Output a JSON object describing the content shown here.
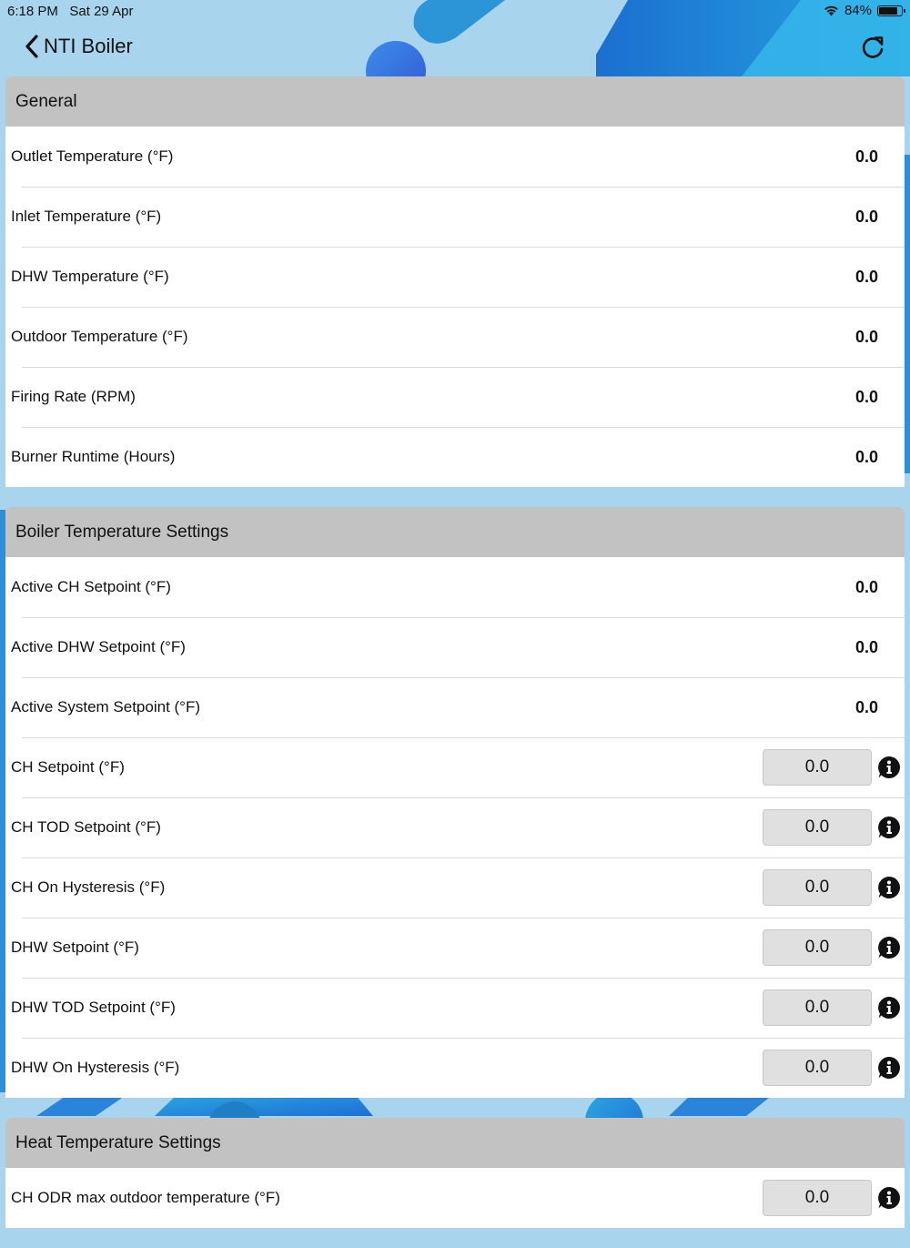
{
  "status_bar": {
    "time": "6:18 PM",
    "date": "Sat 29 Apr",
    "battery": "84%",
    "battery_level": 0.84
  },
  "nav": {
    "back_label": "NTI Boiler",
    "back_icon": "chevron-left-icon",
    "refresh_icon": "refresh-icon"
  },
  "sections": [
    {
      "title": "General",
      "rows": [
        {
          "label": "Outlet Temperature (°F)",
          "value": "0.0"
        },
        {
          "label": "Inlet Temperature (°F)",
          "value": "0.0"
        },
        {
          "label": "DHW Temperature (°F)",
          "value": "0.0"
        },
        {
          "label": "Outdoor Temperature (°F)",
          "value": "0.0"
        },
        {
          "label": "Firing Rate (RPM)",
          "value": "0.0"
        },
        {
          "label": "Burner Runtime (Hours)",
          "value": "0.0"
        }
      ]
    },
    {
      "title": "Boiler Temperature Settings",
      "rows": [
        {
          "label": "Active CH Setpoint (°F)",
          "value": "0.0"
        },
        {
          "label": "Active DHW Setpoint (°F)",
          "value": "0.0"
        },
        {
          "label": "Active System Setpoint (°F)",
          "value": "0.0"
        },
        {
          "label": "CH Setpoint (°F)",
          "input": "0.0"
        },
        {
          "label": "CH TOD Setpoint (°F)",
          "input": "0.0"
        },
        {
          "label": "CH On Hysteresis (°F)",
          "input": "0.0"
        },
        {
          "label": "DHW Setpoint (°F)",
          "input": "0.0"
        },
        {
          "label": "DHW TOD Setpoint (°F)",
          "input": "0.0"
        },
        {
          "label": "DHW On Hysteresis (°F)",
          "input": "0.0"
        }
      ]
    },
    {
      "title": "Heat Temperature Settings",
      "rows": [
        {
          "label": "CH ODR max outdoor temperature (°F)",
          "input": "0.0"
        }
      ]
    }
  ],
  "colors": {
    "background": "#a9d4ee",
    "header": "#c2c2c2",
    "accent": "#1f7fd6"
  },
  "info_icon": "info-icon"
}
